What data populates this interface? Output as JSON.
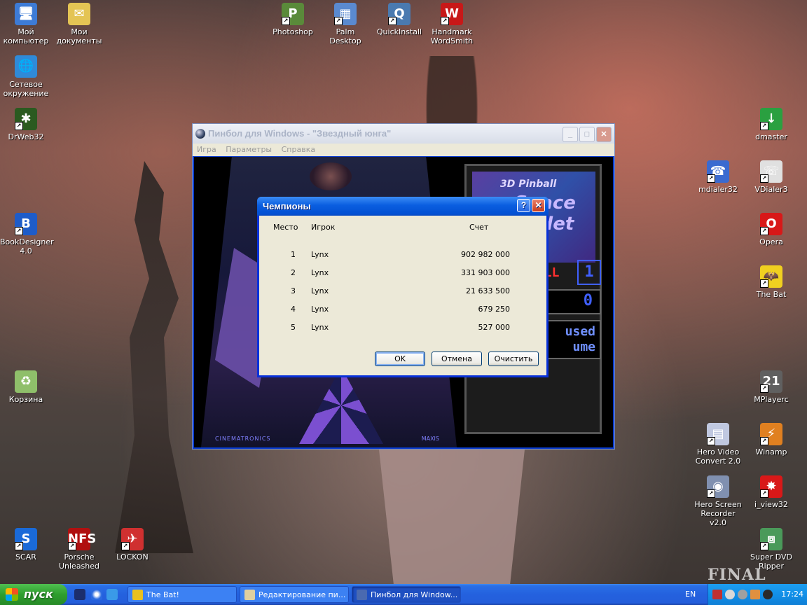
{
  "desktop": {
    "icons": [
      {
        "label": "Мой компьютер",
        "glyph": "🖥",
        "bg": "#3d7bd6"
      },
      {
        "label": "Мои документы",
        "glyph": "✉",
        "bg": "#e4c454"
      },
      {
        "label": "Сетевое окружение",
        "glyph": "🌐",
        "bg": "#2f8ad8"
      },
      {
        "label": "DrWeb32",
        "glyph": "✱",
        "bg": "#2b5a20"
      },
      {
        "label": "BookDesigner 4.0",
        "glyph": "B",
        "bg": "#1e5cc8"
      },
      {
        "label": "Корзина",
        "glyph": "♻",
        "bg": "#8fbf6a"
      },
      {
        "label": "SCAR",
        "glyph": "S",
        "bg": "#1a6ad8"
      },
      {
        "label": "Porsche Unleashed",
        "glyph": "NFS",
        "bg": "#b01010"
      },
      {
        "label": "LOCKON",
        "glyph": "✈",
        "bg": "#d03030"
      },
      {
        "label": "Photoshop",
        "glyph": "P",
        "bg": "#5a8a3a"
      },
      {
        "label": "Palm Desktop",
        "glyph": "▦",
        "bg": "#5a8ad0"
      },
      {
        "label": "QuickInstall",
        "glyph": "Q",
        "bg": "#4a7ab0"
      },
      {
        "label": "Handmark WordSmith",
        "glyph": "W",
        "bg": "#c81818"
      },
      {
        "label": "dmaster",
        "glyph": "↓",
        "bg": "#2aa040"
      },
      {
        "label": "mdialer32",
        "glyph": "☎",
        "bg": "#3a6ad0"
      },
      {
        "label": "VDialer3",
        "glyph": "☏",
        "bg": "#e0e0e0"
      },
      {
        "label": "Opera",
        "glyph": "O",
        "bg": "#d81818"
      },
      {
        "label": "The Bat",
        "glyph": "🦇",
        "bg": "#f0d020"
      },
      {
        "label": "MPlayerc",
        "glyph": "21",
        "bg": "#606060"
      },
      {
        "label": "Hero Video Convert 2.0",
        "glyph": "▤",
        "bg": "#c0c8e0"
      },
      {
        "label": "Winamp",
        "glyph": "⚡",
        "bg": "#e08020"
      },
      {
        "label": "Hero Screen Recorder v2.0",
        "glyph": "◉",
        "bg": "#8090b0"
      },
      {
        "label": "i_view32",
        "glyph": "✸",
        "bg": "#d81818"
      },
      {
        "label": "Super DVD Ripper",
        "glyph": "⧈",
        "bg": "#4a9a5a"
      }
    ],
    "watermark": "FINAL FANTASY"
  },
  "pinball_window": {
    "title": "Пинбол для Windows - \"Звездный юнга\"",
    "menu": [
      "Игра",
      "Параметры",
      "Справка"
    ],
    "panel": {
      "art_line1": "3D Pinball",
      "art_line2": "Space Cadet",
      "ball_label": "ALL",
      "ball_number": "1",
      "score": "0",
      "status_line1": "used",
      "status_line2": "ume"
    },
    "table_logo_left": "CINEMATRONICS",
    "table_logo_right": "MAXIS"
  },
  "highscores_dialog": {
    "title": "Чемпионы",
    "columns": {
      "rank": "Место",
      "player": "Игрок",
      "score": "Счет"
    },
    "rows": [
      {
        "rank": "1",
        "player": "Lynx",
        "score": "902 982 000"
      },
      {
        "rank": "2",
        "player": "Lynx",
        "score": "331 903 000"
      },
      {
        "rank": "3",
        "player": "Lynx",
        "score": "21 633 500"
      },
      {
        "rank": "4",
        "player": "Lynx",
        "score": "679 250"
      },
      {
        "rank": "5",
        "player": "Lynx",
        "score": "527 000"
      }
    ],
    "buttons": {
      "ok": "OK",
      "cancel": "Отмена",
      "clear": "Очистить"
    }
  },
  "taskbar": {
    "start_label": "пуск",
    "tasks": [
      {
        "label": "The Bat!",
        "color": "#e8c020"
      },
      {
        "label": "Редактирование пи...",
        "color": "#e0d0a0"
      },
      {
        "label": "Пинбол для Window...",
        "color": "#4a6ab0"
      }
    ],
    "language": "EN",
    "clock": "17:24"
  }
}
